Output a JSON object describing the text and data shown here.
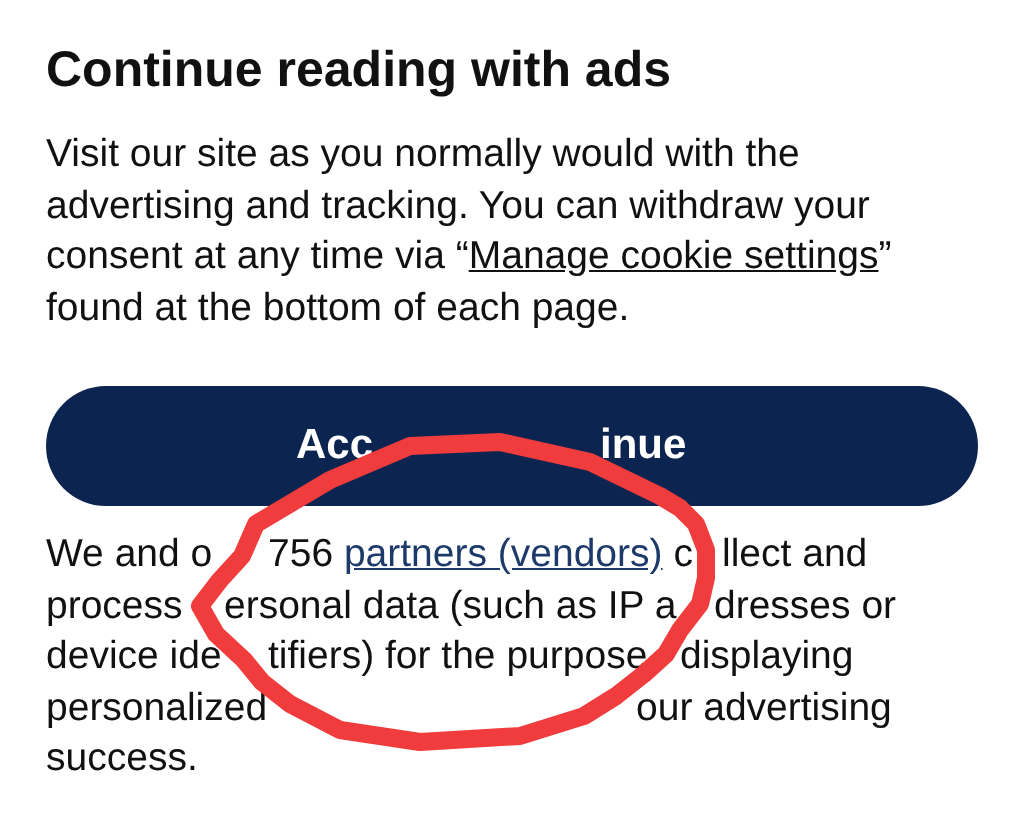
{
  "heading": "Continue reading with ads",
  "intro": {
    "before": "Visit our site as you normally would with the advertising and tracking. You can withdraw your consent at any time via “",
    "link": "Manage cookie settings",
    "after": "” found at the bottom of each page."
  },
  "button": [
    "Acc",
    "inue"
  ],
  "notice": [
    [
      {
        "text": "We and o"
      },
      {
        "before": "756 ",
        "link": "partners (vendors)",
        "after": " c"
      },
      {
        "text": "llect and"
      }
    ],
    [
      {
        "text": "process"
      },
      {
        "text": "ersonal data (such as IP a"
      },
      {
        "text": "dresses or"
      }
    ],
    [
      {
        "text": "device ide"
      },
      {
        "text": "tifiers) for the purpose"
      },
      {
        "text": "displaying"
      }
    ],
    [
      {
        "text": "personalized"
      },
      {
        "text": "our advertising"
      }
    ],
    [
      {
        "text": "success."
      }
    ]
  ]
}
